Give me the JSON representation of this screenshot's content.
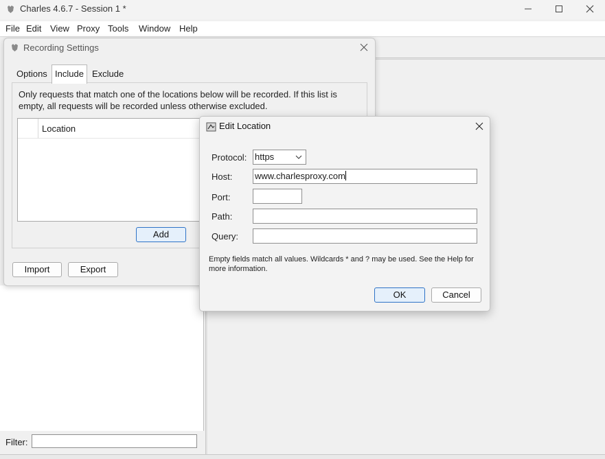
{
  "window": {
    "title": "Charles 4.6.7 - Session 1 *",
    "minimize_symbol": "—",
    "close_symbol": "✕"
  },
  "menu": [
    "File",
    "Edit",
    "View",
    "Proxy",
    "Tools",
    "Window",
    "Help"
  ],
  "filter": {
    "label": "Filter:",
    "value": ""
  },
  "recording_settings": {
    "title": "Recording Settings",
    "tabs": [
      "Options",
      "Include",
      "Exclude"
    ],
    "active_tab": "Include",
    "description": "Only requests that match one of the locations below will be recorded. If this list is empty, all requests will be recorded unless otherwise excluded.",
    "table": {
      "column": "Location",
      "rows": []
    },
    "add_label": "Add",
    "import_label": "Import",
    "export_label": "Export"
  },
  "edit_location": {
    "title": "Edit Location",
    "protocol_label": "Protocol:",
    "protocol_value": "https",
    "host_label": "Host:",
    "host_value": "www.charlesproxy.com",
    "port_label": "Port:",
    "port_value": "",
    "path_label": "Path:",
    "path_value": "",
    "query_label": "Query:",
    "query_value": "",
    "help_text": "Empty fields match all values. Wildcards * and ? may be used. See the Help for more information.",
    "ok_label": "OK",
    "cancel_label": "Cancel"
  },
  "colors": {
    "accent": "#2d72c6",
    "dialog_bg": "#f0f0f0"
  }
}
